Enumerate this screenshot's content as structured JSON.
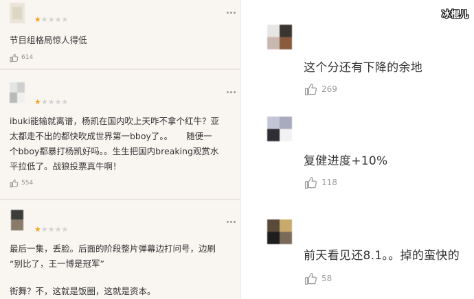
{
  "left": {
    "comments": [
      {
        "rating": 1,
        "lines": [
          "节目组格局惊人得低"
        ],
        "likes": "614"
      },
      {
        "rating": 1,
        "lines": [
          "ibuki能输就离谱，杨凯在国内吹上天咋不拿个红牛？亚",
          "太都走不出的都快吹成世界第一bboy了。。     随便一",
          "个bboy都暴打杨凯好吗。。生生把国内breaking观赏水",
          "平拉低了。战狼投票真牛啊！"
        ],
        "likes": "554"
      },
      {
        "rating": 1,
        "lines": [
          "最后一集，丢脸。后面的阶段整片弹幕边打问号，边刷",
          "“别比了，王一博是冠军”",
          "",
          "街舞？不，这就是饭圈，这就是资本。"
        ],
        "likes": ""
      }
    ]
  },
  "right": {
    "comments": [
      {
        "text": "这个分还有下降的余地",
        "likes": "269"
      },
      {
        "text": "复健进度+10%",
        "likes": "118"
      },
      {
        "text": "前天看见还8.1。。掉的蛮快的",
        "likes": "58"
      }
    ]
  },
  "watermark": "冰棍儿",
  "icons": {
    "like": "thumbs-up-icon",
    "more": "more-dots-icon",
    "star": "star-icon"
  },
  "colors": {
    "star_on": "#f4a11d",
    "star_off": "#d2d2d2",
    "left_bg": "#f9f6f2"
  }
}
